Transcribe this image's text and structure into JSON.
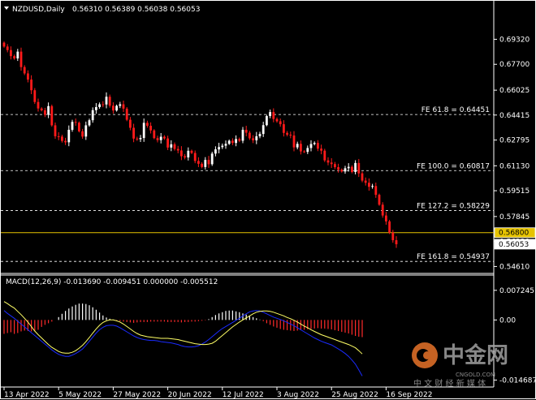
{
  "header": {
    "symbol_label": "NZDUSD,Daily",
    "ohlc": "0.56310 0.56389 0.56038 0.56053"
  },
  "macd_header": "MACD(12,26,9) -0.013690 -0.009451 0.000000 -0.005512",
  "watermark": {
    "logo_text": "中金网",
    "domain": "CNGOLD.COM",
    "tagline": "中 文 财 经 新 媒 体"
  },
  "colors": {
    "background": "#000000",
    "bull": "#ffffff",
    "bear": "#ff1a1a",
    "fib_line": "#ffffff",
    "price_line": "#e6c300",
    "macd_hist_pos": "#ffffff",
    "macd_hist_neg": "#ff2a2a",
    "macd_line": "#1a2bff",
    "signal_line": "#ffff66",
    "current_price_box": "#e6c300"
  },
  "chart_data": [
    {
      "type": "candlestick",
      "title": "NZDUSD,Daily",
      "ylim": [
        0.5437,
        0.7097
      ],
      "y_ticks": [
        "0.69320",
        "0.67700",
        "0.66025",
        "0.64415",
        "0.62795",
        "0.61130",
        "0.59515",
        "0.57845",
        "0.56230",
        "0.54610"
      ],
      "y_tick_values": [
        0.6932,
        0.677,
        0.66025,
        0.64415,
        0.62795,
        0.6113,
        0.59515,
        0.57845,
        0.5623,
        0.5461
      ],
      "x_tick_labels": [
        "13 Apr 2022",
        "5 May 2022",
        "27 May 2022",
        "20 Jun 2022",
        "12 Jul 2022",
        "3 Aug 2022",
        "25 Aug 2022",
        "16 Sep 2022"
      ],
      "x_tick_indices": [
        0,
        16,
        32,
        48,
        64,
        80,
        96,
        112
      ],
      "fib_levels": [
        {
          "label": "FE 61.8 = 0.64451",
          "value": 0.64451
        },
        {
          "label": "FE 100.0 = 0.60817",
          "value": 0.60817
        },
        {
          "label": "FE 127.2 = 0.58229",
          "value": 0.58229
        },
        {
          "label": "FE 161.8 = 0.54937",
          "value": 0.54937
        }
      ],
      "price_line": {
        "label": "0.56800",
        "value": 0.568
      },
      "current_price": {
        "label": "0.56053",
        "value": 0.56053
      },
      "close": [
        0.6885,
        0.6862,
        0.6823,
        0.6808,
        0.6852,
        0.6752,
        0.6711,
        0.6671,
        0.6602,
        0.6526,
        0.6484,
        0.6472,
        0.6443,
        0.6499,
        0.6375,
        0.6304,
        0.6302,
        0.6274,
        0.6265,
        0.6346,
        0.6397,
        0.6392,
        0.6336,
        0.6302,
        0.6375,
        0.6408,
        0.6473,
        0.6493,
        0.6511,
        0.651,
        0.656,
        0.6502,
        0.6471,
        0.6501,
        0.6511,
        0.6483,
        0.6411,
        0.6359,
        0.6289,
        0.6285,
        0.6293,
        0.6391,
        0.6372,
        0.6342,
        0.6292,
        0.6279,
        0.6301,
        0.629,
        0.6231,
        0.6252,
        0.6222,
        0.6212,
        0.6175,
        0.6167,
        0.621,
        0.6196,
        0.6144,
        0.6126,
        0.6105,
        0.6151,
        0.6123,
        0.6192,
        0.6219,
        0.6234,
        0.6243,
        0.6255,
        0.6275,
        0.6261,
        0.6286,
        0.6275,
        0.6346,
        0.6327,
        0.6291,
        0.6278,
        0.6304,
        0.6319,
        0.6376,
        0.6435,
        0.6461,
        0.6416,
        0.6401,
        0.6382,
        0.6326,
        0.6314,
        0.6309,
        0.6232,
        0.6255,
        0.6206,
        0.6203,
        0.6228,
        0.6254,
        0.6261,
        0.6224,
        0.6211,
        0.6148,
        0.6134,
        0.6124,
        0.6104,
        0.6088,
        0.6076,
        0.6097,
        0.6106,
        0.6073,
        0.6131,
        0.6064,
        0.6017,
        0.6003,
        0.5977,
        0.5982,
        0.5925,
        0.5861,
        0.5791,
        0.5753,
        0.568,
        0.5631,
        0.5605
      ]
    },
    {
      "type": "macd",
      "title": "MACD(12,26,9) -0.013690 -0.009451 0.000000 -0.005512",
      "ylim": [
        -0.0156,
        0.0082
      ],
      "y_ticks": [
        "0.007245",
        "0.00",
        "-0.014687"
      ],
      "y_tick_values": [
        0.007245,
        0.0,
        -0.014687
      ],
      "macd_hist": [
        -0.0034,
        -0.0032,
        -0.003,
        -0.0034,
        -0.0032,
        -0.0028,
        -0.0026,
        -0.0027,
        -0.0028,
        -0.0027,
        -0.0024,
        -0.0017,
        -0.0012,
        -0.0008,
        -0.0004,
        0.0,
        0.0007,
        0.0015,
        0.0022,
        0.0028,
        0.0033,
        0.0037,
        0.004,
        0.004,
        0.0039,
        0.0036,
        0.0031,
        0.0025,
        0.0018,
        0.0011,
        0.0006,
        0.0003,
        0.0001,
        -0.0001,
        -0.0003,
        -0.0004,
        -0.0005,
        -0.0006,
        -0.0007,
        -0.0006,
        -0.0005,
        -0.0005,
        -0.0005,
        -0.0004,
        -0.0004,
        -0.0004,
        -0.0004,
        -0.0004,
        -0.0005,
        -0.0005,
        -0.0005,
        -0.0005,
        -0.0006,
        -0.0005,
        -0.0005,
        -0.0004,
        -0.0004,
        -0.0003,
        -0.0002,
        -0.0001,
        0.0002,
        0.0007,
        0.0012,
        0.0016,
        0.0019,
        0.0022,
        0.0023,
        0.0023,
        0.0021,
        0.0019,
        0.0016,
        0.0013,
        0.001,
        0.0007,
        0.0004,
        0.0001,
        -0.0003,
        -0.0008,
        -0.0012,
        -0.0016,
        -0.0019,
        -0.0022,
        -0.0024,
        -0.0025,
        -0.0026,
        -0.0027,
        -0.0026,
        -0.0025,
        -0.0024,
        -0.0023,
        -0.0022,
        -0.0021,
        -0.002,
        -0.0021,
        -0.0021,
        -0.0022,
        -0.0023,
        -0.0025,
        -0.0027,
        -0.0029,
        -0.0031,
        -0.0033,
        -0.0036,
        -0.0039,
        -0.0041,
        -0.0042
      ],
      "macd_line": [
        0.0023,
        0.0016,
        0.001,
        0.0004,
        -0.0003,
        -0.001,
        -0.0017,
        -0.0024,
        -0.0031,
        -0.0038,
        -0.0045,
        -0.0052,
        -0.0059,
        -0.0066,
        -0.0073,
        -0.0079,
        -0.0084,
        -0.0087,
        -0.0089,
        -0.0089,
        -0.0086,
        -0.0082,
        -0.0077,
        -0.0071,
        -0.0062,
        -0.0052,
        -0.0042,
        -0.0032,
        -0.0024,
        -0.0018,
        -0.0014,
        -0.0013,
        -0.0013,
        -0.0015,
        -0.0019,
        -0.0024,
        -0.0029,
        -0.0034,
        -0.0039,
        -0.0043,
        -0.0046,
        -0.0048,
        -0.0049,
        -0.005,
        -0.005,
        -0.0051,
        -0.0053,
        -0.0054,
        -0.0055,
        -0.0056,
        -0.0058,
        -0.006,
        -0.0063,
        -0.0065,
        -0.0066,
        -0.0066,
        -0.0065,
        -0.0063,
        -0.0059,
        -0.0054,
        -0.0048,
        -0.0041,
        -0.0034,
        -0.0027,
        -0.0021,
        -0.0016,
        -0.0011,
        -0.0006,
        -0.0001,
        0.0004,
        0.001,
        0.0015,
        0.002,
        0.0022,
        0.0023,
        0.0022,
        0.0019,
        0.0015,
        0.0011,
        0.0007,
        0.0004,
        0.0001,
        -0.0002,
        -0.0006,
        -0.001,
        -0.0014,
        -0.0019,
        -0.0024,
        -0.0029,
        -0.0034,
        -0.0039,
        -0.0044,
        -0.0048,
        -0.0052,
        -0.0055,
        -0.0058,
        -0.0061,
        -0.0066,
        -0.0071,
        -0.0076,
        -0.0082,
        -0.0089,
        -0.0098,
        -0.0108,
        -0.0122,
        -0.0137
      ],
      "signal_line": [
        0.0045,
        0.004,
        0.0034,
        0.0029,
        0.0021,
        0.0013,
        0.0004,
        -0.0005,
        -0.0016,
        -0.0027,
        -0.0036,
        -0.0044,
        -0.0052,
        -0.006,
        -0.0067,
        -0.0072,
        -0.0077,
        -0.008,
        -0.0081,
        -0.0081,
        -0.0079,
        -0.0075,
        -0.0069,
        -0.0062,
        -0.0053,
        -0.0043,
        -0.0032,
        -0.0022,
        -0.0013,
        -0.0006,
        -0.0002,
        0.0,
        0.0,
        -0.0002,
        -0.0005,
        -0.001,
        -0.0016,
        -0.0022,
        -0.0028,
        -0.0033,
        -0.0037,
        -0.0039,
        -0.0041,
        -0.0042,
        -0.0043,
        -0.0044,
        -0.0045,
        -0.0045,
        -0.0045,
        -0.0046,
        -0.0047,
        -0.0048,
        -0.005,
        -0.0052,
        -0.0054,
        -0.0056,
        -0.0058,
        -0.0059,
        -0.006,
        -0.006,
        -0.0059,
        -0.0057,
        -0.0052,
        -0.0045,
        -0.0038,
        -0.0031,
        -0.0024,
        -0.0017,
        -0.0011,
        -0.0005,
        0.0,
        0.0005,
        0.001,
        0.0015,
        0.0019,
        0.0021,
        0.0022,
        0.0022,
        0.0021,
        0.0019,
        0.0016,
        0.0013,
        0.001,
        0.0006,
        0.0003,
        -0.0001,
        -0.0005,
        -0.001,
        -0.0015,
        -0.0019,
        -0.0024,
        -0.0028,
        -0.0032,
        -0.0036,
        -0.0039,
        -0.0042,
        -0.0045,
        -0.0048,
        -0.0051,
        -0.0054,
        -0.0057,
        -0.006,
        -0.0064,
        -0.0068,
        -0.0075,
        -0.0083
      ]
    }
  ]
}
